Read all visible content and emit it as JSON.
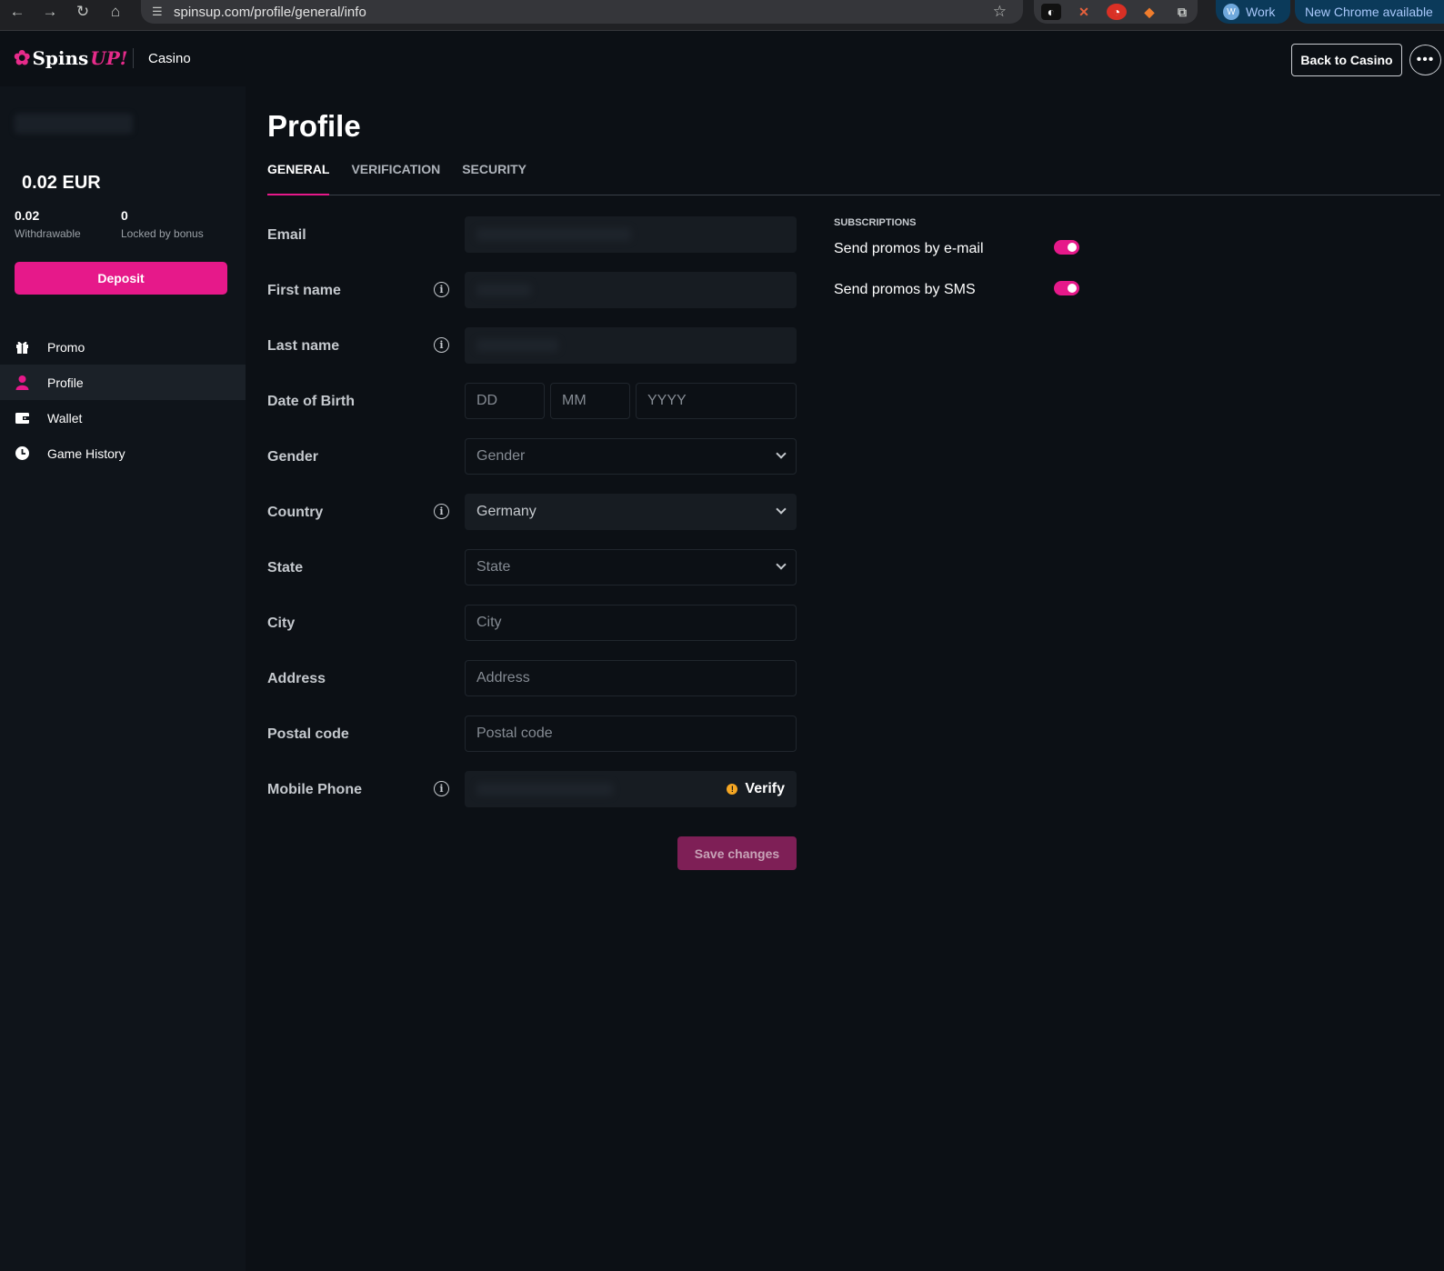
{
  "browser": {
    "url": "spinsup.com/profile/general/info",
    "profile_label": "Work",
    "profile_initial": "W",
    "update_label": "New Chrome available",
    "icons": [
      "back-arrow-icon",
      "forward-arrow-icon",
      "reload-icon",
      "home-icon",
      "site-settings-icon",
      "bookmark-star-icon",
      "extension-icon",
      "kebab-menu-icon"
    ]
  },
  "header": {
    "brand_mark": "✿",
    "brand_spins": "Spins",
    "brand_up": "UP!",
    "nav_label": "Casino",
    "back_label": "Back to Casino",
    "more_label": "•••"
  },
  "sidebar": {
    "balance": "0.02 EUR",
    "withdrawable_value": "0.02",
    "withdrawable_label": "Withdrawable",
    "locked_value": "0",
    "locked_label": "Locked by bonus",
    "deposit_label": "Deposit",
    "items": [
      {
        "label": "Promo",
        "icon": "gift-icon",
        "active": false
      },
      {
        "label": "Profile",
        "icon": "user-icon",
        "active": true
      },
      {
        "label": "Wallet",
        "icon": "wallet-icon",
        "active": false
      },
      {
        "label": "Game History",
        "icon": "clock-icon",
        "active": false
      }
    ]
  },
  "main": {
    "title": "Profile",
    "tabs": [
      {
        "label": "GENERAL",
        "active": true
      },
      {
        "label": "VERIFICATION",
        "active": false
      },
      {
        "label": "SECURITY",
        "active": false
      }
    ],
    "form": {
      "email_label": "Email",
      "first_name_label": "First name",
      "last_name_label": "Last name",
      "dob_label": "Date of Birth",
      "dob_day_placeholder": "DD",
      "dob_month_placeholder": "MM",
      "dob_year_placeholder": "YYYY",
      "gender_label": "Gender",
      "gender_placeholder": "Gender",
      "country_label": "Country",
      "country_value": "Germany",
      "state_label": "State",
      "state_placeholder": "State",
      "city_label": "City",
      "city_placeholder": "City",
      "address_label": "Address",
      "address_placeholder": "Address",
      "postal_label": "Postal code",
      "postal_placeholder": "Postal code",
      "phone_label": "Mobile Phone",
      "verify_label": "Verify",
      "info_glyph": "i",
      "verify_glyph": "!",
      "save_label": "Save changes"
    },
    "subscriptions": {
      "title": "SUBSCRIPTIONS",
      "email_label": "Send promos by e-mail",
      "email_on": true,
      "sms_label": "Send promos by SMS",
      "sms_on": true
    }
  },
  "colors": {
    "accent": "#e6198a",
    "background": "#0c1015",
    "sidebar": "#0f141a",
    "save_disabled": "#7e1f56",
    "verify_warning": "#f5a623"
  }
}
